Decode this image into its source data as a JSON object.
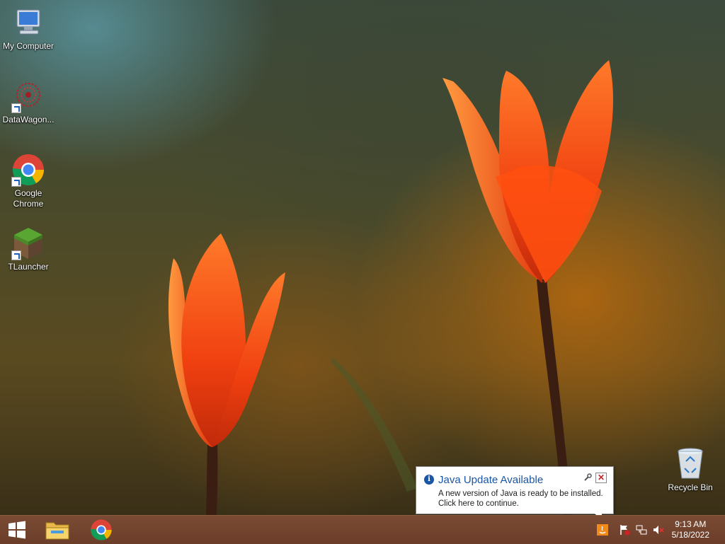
{
  "desktop": {
    "icons": [
      {
        "label": "My Computer",
        "icon": "computer-icon"
      },
      {
        "label": "DataWagon...",
        "icon": "datawagon-icon"
      },
      {
        "label": "Google Chrome",
        "icon": "chrome-icon"
      },
      {
        "label": "TLauncher",
        "icon": "minecraft-block-icon"
      },
      {
        "label": "Recycle Bin",
        "icon": "recycle-bin-icon"
      }
    ]
  },
  "notification": {
    "title": "Java Update Available",
    "line1": "A new version of Java is ready to be installed.",
    "line2": "Click here to continue.",
    "close_glyph": "✕"
  },
  "taskbar": {
    "pinned": [
      {
        "name": "start-button",
        "icon": "windows-logo-icon"
      },
      {
        "name": "file-explorer-button",
        "icon": "folder-icon"
      },
      {
        "name": "chrome-taskbar-button",
        "icon": "chrome-icon"
      }
    ],
    "tray": [
      "java-update-icon",
      "action-center-flag-icon",
      "network-icon",
      "volume-muted-icon"
    ],
    "clock": {
      "time": "9:13 AM",
      "date": "5/18/2022"
    }
  },
  "colors": {
    "taskbar": "#6b3e2a",
    "balloon_title": "#1a56a6",
    "tulip": "#ff4a10"
  }
}
